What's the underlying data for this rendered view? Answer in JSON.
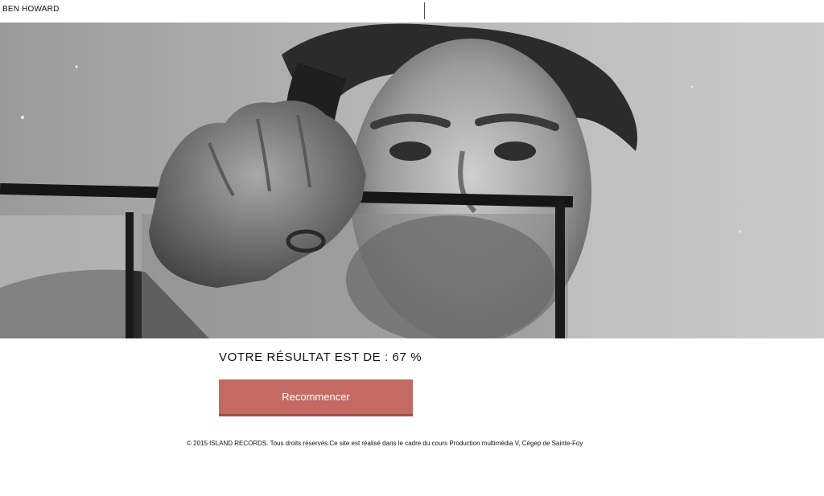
{
  "header": {
    "brand": "BEN HOWARD"
  },
  "hero": {
    "description_icon": "portrait-photo"
  },
  "result": {
    "text": "VOTRE RÉSULTAT EST DE : 67 %"
  },
  "actions": {
    "restart_label": "Recommencer"
  },
  "footer": {
    "text": "© 2015 ISLAND RECORDS. Tous droits réservés.Ce site est réalisé dans le cadre du cours Production multimédia V, Cégep de Sainte-Foy"
  },
  "colors": {
    "button": "#c46a63",
    "background": "#ffffff"
  }
}
